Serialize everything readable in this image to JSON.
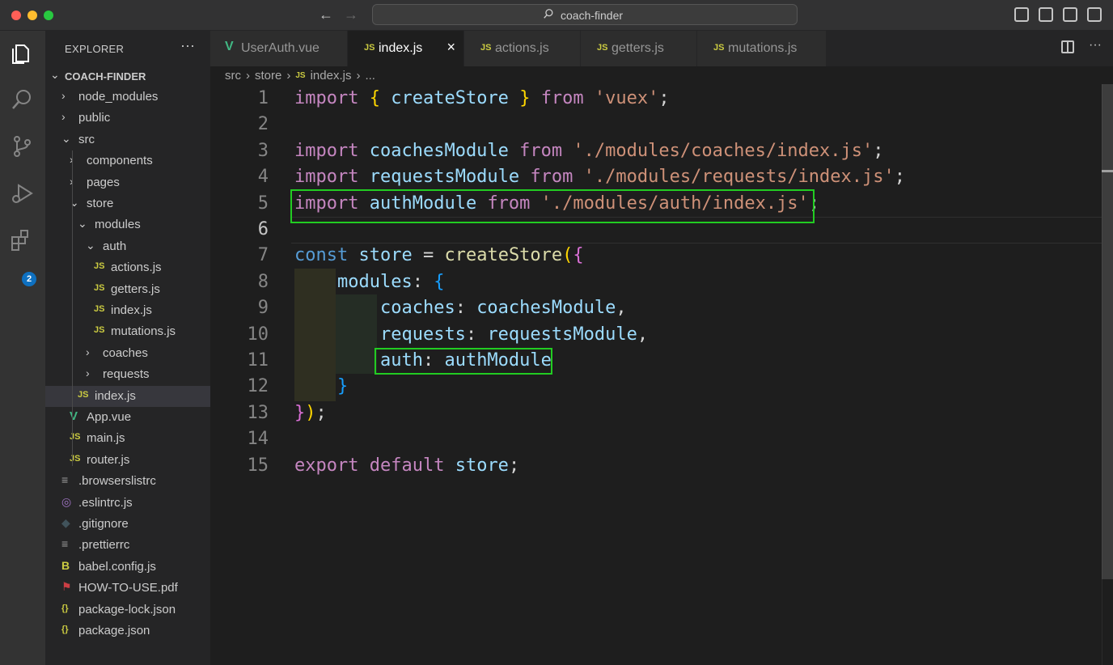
{
  "window": {
    "title": "coach-finder",
    "nav_back": "←",
    "nav_forward": "→"
  },
  "activity_bar": {
    "items": [
      "explorer-icon",
      "search-icon",
      "source-control-icon",
      "run-debug-icon",
      "extensions-icon"
    ],
    "extensions_badge": "2"
  },
  "sidebar": {
    "title": "EXPLORER",
    "more": "···",
    "root": "COACH-FINDER",
    "tree": [
      {
        "label": "node_modules",
        "type": "folder",
        "expanded": false
      },
      {
        "label": "public",
        "type": "folder",
        "expanded": false
      },
      {
        "label": "src",
        "type": "folder",
        "expanded": true
      },
      {
        "label": "components",
        "type": "folder",
        "expanded": false
      },
      {
        "label": "pages",
        "type": "folder",
        "expanded": false
      },
      {
        "label": "store",
        "type": "folder",
        "expanded": true
      },
      {
        "label": "modules",
        "type": "folder",
        "expanded": true
      },
      {
        "label": "auth",
        "type": "folder",
        "expanded": true
      },
      {
        "label": "actions.js",
        "type": "js"
      },
      {
        "label": "getters.js",
        "type": "js"
      },
      {
        "label": "index.js",
        "type": "js"
      },
      {
        "label": "mutations.js",
        "type": "js"
      },
      {
        "label": "coaches",
        "type": "folder",
        "expanded": false
      },
      {
        "label": "requests",
        "type": "folder",
        "expanded": false
      },
      {
        "label": "index.js",
        "type": "js",
        "selected": true
      },
      {
        "label": "App.vue",
        "type": "vue"
      },
      {
        "label": "main.js",
        "type": "js"
      },
      {
        "label": "router.js",
        "type": "js"
      },
      {
        "label": ".browserslistrc",
        "type": "config"
      },
      {
        "label": ".eslintrc.js",
        "type": "eslint"
      },
      {
        "label": ".gitignore",
        "type": "git"
      },
      {
        "label": ".prettierrc",
        "type": "config"
      },
      {
        "label": "babel.config.js",
        "type": "babel"
      },
      {
        "label": "HOW-TO-USE.pdf",
        "type": "pdf"
      },
      {
        "label": "package-lock.json",
        "type": "json"
      },
      {
        "label": "package.json",
        "type": "json"
      }
    ]
  },
  "tabs": [
    {
      "label": "UserAuth.vue",
      "icon": "V",
      "type": "vue"
    },
    {
      "label": "index.js",
      "icon": "JS",
      "type": "js",
      "active": true,
      "close": "×"
    },
    {
      "label": "actions.js",
      "icon": "JS",
      "type": "js"
    },
    {
      "label": "getters.js",
      "icon": "JS",
      "type": "js"
    },
    {
      "label": "mutations.js",
      "icon": "JS",
      "type": "js"
    }
  ],
  "breadcrumb": {
    "parts": [
      "src",
      "store",
      "index.js",
      "..."
    ],
    "sep": "›",
    "js_icon": "JS"
  },
  "editor": {
    "current_line": 6,
    "line_numbers": [
      "1",
      "2",
      "3",
      "4",
      "5",
      "6",
      "7",
      "8",
      "9",
      "10",
      "11",
      "12",
      "13",
      "14",
      "15"
    ],
    "lines": [
      [
        [
          "k",
          "import"
        ],
        [
          "p",
          " "
        ],
        [
          "b1",
          "{"
        ],
        [
          "p",
          " "
        ],
        [
          "v",
          "createStore"
        ],
        [
          "p",
          " "
        ],
        [
          "b1",
          "}"
        ],
        [
          "p",
          " "
        ],
        [
          "k",
          "from"
        ],
        [
          "p",
          " "
        ],
        [
          "s",
          "'vuex'"
        ],
        [
          "p",
          ";"
        ]
      ],
      [],
      [
        [
          "k",
          "import"
        ],
        [
          "p",
          " "
        ],
        [
          "v",
          "coachesModule"
        ],
        [
          "p",
          " "
        ],
        [
          "k",
          "from"
        ],
        [
          "p",
          " "
        ],
        [
          "s",
          "'./modules/coaches/index.js'"
        ],
        [
          "p",
          ";"
        ]
      ],
      [
        [
          "k",
          "import"
        ],
        [
          "p",
          " "
        ],
        [
          "v",
          "requestsModule"
        ],
        [
          "p",
          " "
        ],
        [
          "k",
          "from"
        ],
        [
          "p",
          " "
        ],
        [
          "s",
          "'./modules/requests/index.js'"
        ],
        [
          "p",
          ";"
        ]
      ],
      [
        [
          "k",
          "import"
        ],
        [
          "p",
          " "
        ],
        [
          "v",
          "authModule"
        ],
        [
          "p",
          " "
        ],
        [
          "k",
          "from"
        ],
        [
          "p",
          " "
        ],
        [
          "s",
          "'./modules/auth/index.js'"
        ],
        [
          "p",
          ";"
        ]
      ],
      [],
      [
        [
          "kb",
          "const"
        ],
        [
          "p",
          " "
        ],
        [
          "v",
          "store"
        ],
        [
          "p",
          " = "
        ],
        [
          "f",
          "createStore"
        ],
        [
          "b1",
          "("
        ],
        [
          "b2",
          "{"
        ]
      ],
      [
        [
          "p",
          "    "
        ],
        [
          "v",
          "modules"
        ],
        [
          "p",
          ": "
        ],
        [
          "b3",
          "{"
        ]
      ],
      [
        [
          "p",
          "        "
        ],
        [
          "v",
          "coaches"
        ],
        [
          "p",
          ": "
        ],
        [
          "v",
          "coachesModule"
        ],
        [
          "p",
          ","
        ]
      ],
      [
        [
          "p",
          "        "
        ],
        [
          "v",
          "requests"
        ],
        [
          "p",
          ": "
        ],
        [
          "v",
          "requestsModule"
        ],
        [
          "p",
          ","
        ]
      ],
      [
        [
          "p",
          "        "
        ],
        [
          "v",
          "auth"
        ],
        [
          "p",
          ": "
        ],
        [
          "v",
          "authModule"
        ]
      ],
      [
        [
          "p",
          "    "
        ],
        [
          "b3",
          "}"
        ]
      ],
      [
        [
          "b2",
          "}"
        ],
        [
          "b1",
          ")"
        ],
        [
          "p",
          ";"
        ]
      ],
      [],
      [
        [
          "k",
          "export"
        ],
        [
          "p",
          " "
        ],
        [
          "k",
          "default"
        ],
        [
          "p",
          " "
        ],
        [
          "v",
          "store"
        ],
        [
          "p",
          ";"
        ]
      ]
    ]
  }
}
